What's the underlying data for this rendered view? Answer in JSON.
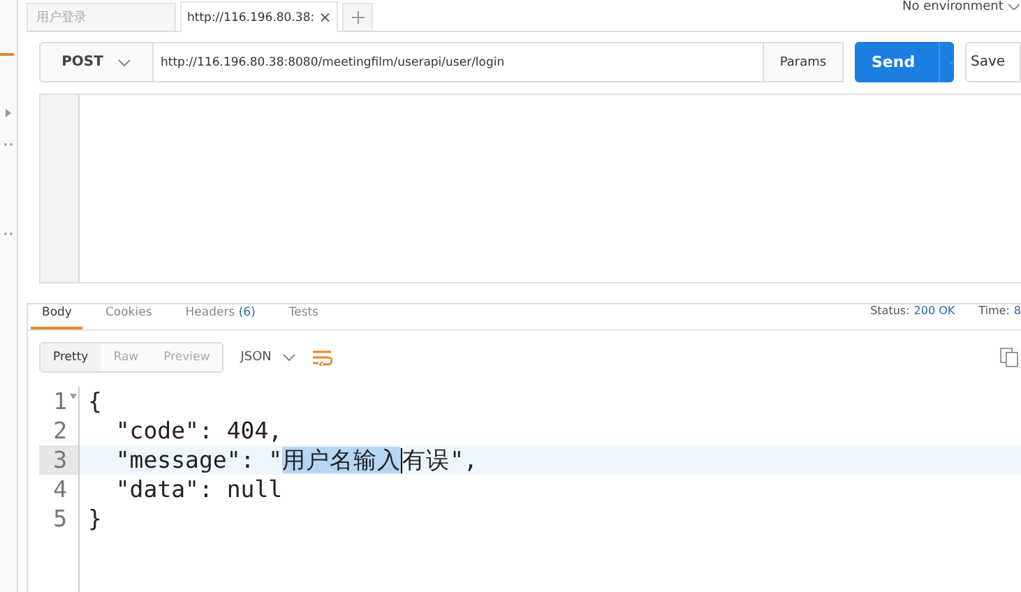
{
  "tabs": [
    {
      "label": "用户登录",
      "selected": false
    },
    {
      "label": "http://116.196.80.38:",
      "selected": true,
      "close": "×"
    }
  ],
  "environment": "No environment",
  "request": {
    "method": "POST",
    "url": "http://116.196.80.38:8080/meetingfilm/userapi/user/login",
    "params": "Params",
    "send": "Send",
    "save": "Save"
  },
  "response": {
    "tabs": [
      {
        "label": "Body",
        "selected": true
      },
      {
        "label": "Cookies",
        "selected": false
      },
      {
        "label": "Headers",
        "count": "(6)",
        "selected": false
      },
      {
        "label": "Tests",
        "selected": false
      }
    ],
    "status_label": "Status:",
    "status": "200 OK",
    "time_label": "Time:",
    "time": "8",
    "views": [
      {
        "label": "Pretty",
        "selected": true
      },
      {
        "label": "Raw",
        "selected": false
      },
      {
        "label": "Preview",
        "selected": false
      }
    ],
    "format": "JSON",
    "lines": [
      {
        "number": "1",
        "active": false,
        "foldable": true,
        "segments": [
          {
            "text": "{",
            "selected": false
          }
        ]
      },
      {
        "number": "2",
        "active": false,
        "foldable": false,
        "segments": [
          {
            "text": "  \"code\": 404,",
            "selected": false
          }
        ]
      },
      {
        "number": "3",
        "active": true,
        "foldable": false,
        "segments": [
          {
            "text": "  \"message\": \"",
            "selected": false
          },
          {
            "text": "用户名输入",
            "selected": true
          },
          {
            "text": "有误\",",
            "selected": false
          }
        ]
      },
      {
        "number": "4",
        "active": false,
        "foldable": false,
        "segments": [
          {
            "text": "  \"data\": null",
            "selected": false
          }
        ]
      },
      {
        "number": "5",
        "active": false,
        "foldable": false,
        "segments": [
          {
            "text": "}",
            "selected": false
          }
        ]
      }
    ]
  }
}
